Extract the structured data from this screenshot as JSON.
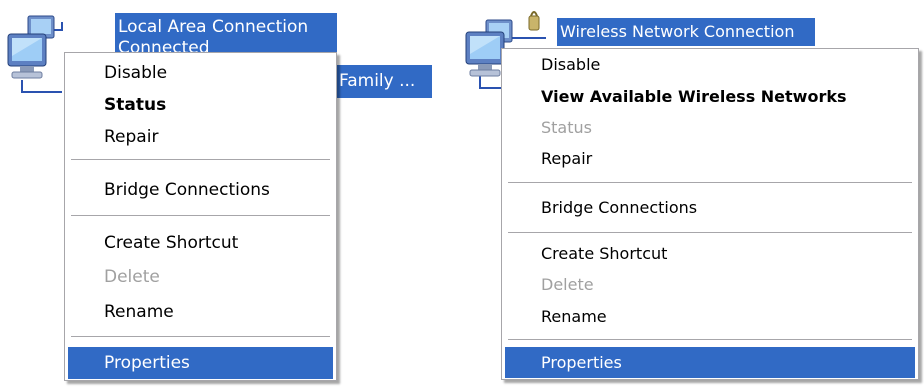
{
  "local_connection": {
    "name": "Local Area Connection",
    "status_line": "Connected",
    "device_line_tail": "Family ..."
  },
  "wireless_connection": {
    "name": "Wireless Network Connection"
  },
  "menu_left": {
    "items": [
      {
        "label": "Disable",
        "style": "normal"
      },
      {
        "label": "Status",
        "style": "bold"
      },
      {
        "label": "Repair",
        "style": "normal"
      },
      {
        "label": "Bridge Connections",
        "style": "normal"
      },
      {
        "label": "Create Shortcut",
        "style": "normal"
      },
      {
        "label": "Delete",
        "style": "disabled"
      },
      {
        "label": "Rename",
        "style": "normal"
      },
      {
        "label": "Properties",
        "style": "highlighted"
      }
    ]
  },
  "menu_right": {
    "items": [
      {
        "label": "Disable",
        "style": "normal"
      },
      {
        "label": "View Available Wireless Networks",
        "style": "bold"
      },
      {
        "label": "Status",
        "style": "disabled"
      },
      {
        "label": "Repair",
        "style": "normal"
      },
      {
        "label": "Bridge Connections",
        "style": "normal"
      },
      {
        "label": "Create Shortcut",
        "style": "normal"
      },
      {
        "label": "Delete",
        "style": "disabled"
      },
      {
        "label": "Rename",
        "style": "normal"
      },
      {
        "label": "Properties",
        "style": "highlighted"
      }
    ]
  },
  "colors": {
    "selection": "#316ac5",
    "menu_border": "#a7a6aa",
    "disabled_text": "#a0a0a0"
  },
  "icons": {
    "local": "network-computers-icon",
    "wireless": "wireless-network-icon"
  }
}
